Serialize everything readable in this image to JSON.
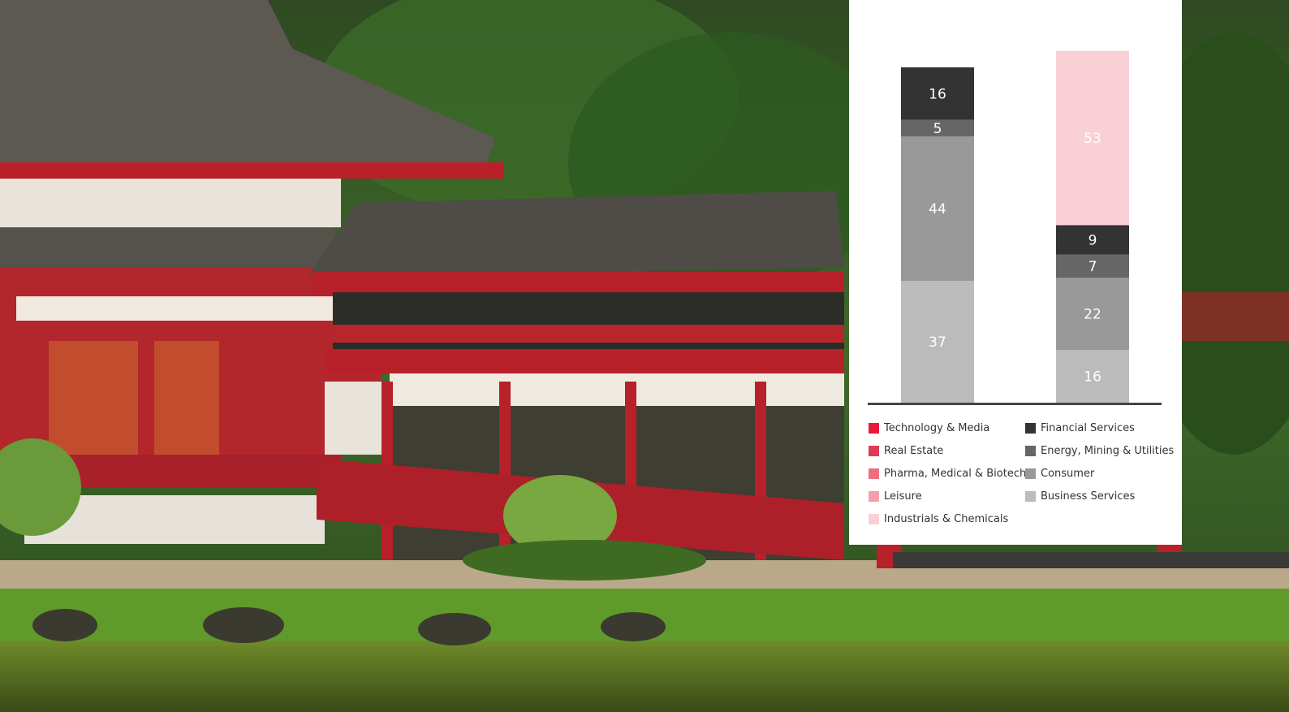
{
  "chart_data": {
    "type": "bar",
    "stacked": true,
    "categories": [
      "",
      ""
    ],
    "series": [
      {
        "name": "Technology & Media",
        "color": "#e8173b",
        "values": [
          null,
          null
        ]
      },
      {
        "name": "Real Estate",
        "color": "#e03a55",
        "values": [
          null,
          null
        ]
      },
      {
        "name": "Pharma, Medical & Biotech",
        "color": "#ea6f80",
        "values": [
          null,
          null
        ]
      },
      {
        "name": "Leisure",
        "color": "#f1a0ac",
        "values": [
          null,
          null
        ]
      },
      {
        "name": "Industrials & Chemicals",
        "color": "#f9d0d6",
        "values": [
          null,
          53
        ]
      },
      {
        "name": "Financial Services",
        "color": "#333333",
        "values": [
          16,
          9
        ]
      },
      {
        "name": "Energy, Mining & Utilities",
        "color": "#666666",
        "values": [
          5,
          7
        ]
      },
      {
        "name": "Consumer",
        "color": "#999999",
        "values": [
          44,
          22
        ]
      },
      {
        "name": "Business Services",
        "color": "#bbbbbb",
        "values": [
          37,
          16
        ]
      }
    ],
    "legend_position": "bottom",
    "grid": false
  }
}
